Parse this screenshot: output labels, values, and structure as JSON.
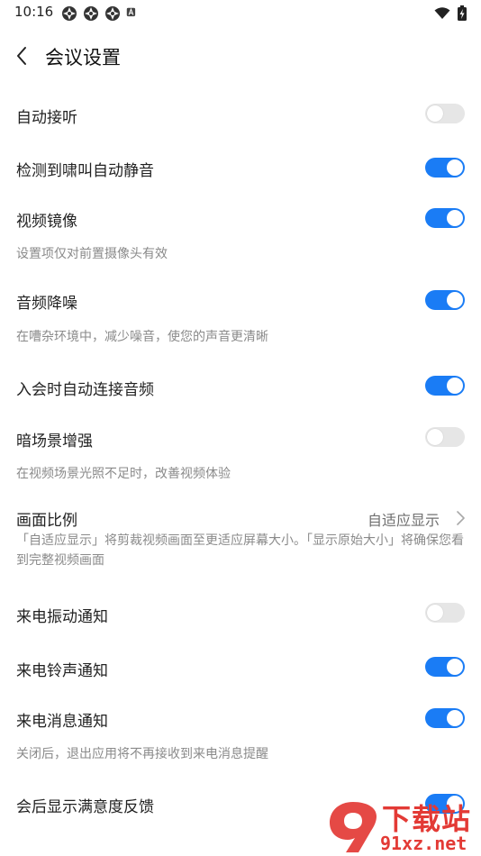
{
  "status_bar": {
    "time": "10:16",
    "notification_icons": [
      "app-notification-icon",
      "app-notification-icon",
      "app-notification-icon",
      "font-a-icon"
    ],
    "right_icons": [
      "wifi-icon",
      "battery-charging-icon"
    ]
  },
  "header": {
    "title": "会议设置"
  },
  "settings": {
    "auto_answer": {
      "label": "自动接听",
      "enabled": false
    },
    "howl_mute": {
      "label": "检测到啸叫自动静音",
      "enabled": true
    },
    "video_mirror": {
      "label": "视频镜像",
      "desc": "设置项仅对前置摄像头有效",
      "enabled": true
    },
    "audio_denoise": {
      "label": "音频降噪",
      "desc": "在嘈杂环境中，减少噪音，使您的声音更清晰",
      "enabled": true
    },
    "auto_audio": {
      "label": "入会时自动连接音频",
      "enabled": true
    },
    "low_light": {
      "label": "暗场景增强",
      "desc": "在视频场景光照不足时，改善视频体验",
      "enabled": false
    },
    "aspect_ratio": {
      "label": "画面比例",
      "value": "自适应显示",
      "desc": "「自适应显示」将剪裁视频画面至更适应屏幕大小。「显示原始大小」将确保您看到完整视频画面"
    },
    "call_vibrate": {
      "label": "来电振动通知",
      "enabled": false
    },
    "call_ring": {
      "label": "来电铃声通知",
      "enabled": true
    },
    "call_message": {
      "label": "来电消息通知",
      "desc": "关闭后，退出应用将不再接收到来电消息提醒",
      "enabled": true
    },
    "satisfaction": {
      "label": "会后显示满意度反馈",
      "enabled": true
    }
  },
  "watermark": {
    "top_text": "下载站",
    "bottom_text": "91xz.net"
  },
  "colors": {
    "toggle_on": "#1a7cf5",
    "toggle_off": "#e6e6e6",
    "watermark": "#e33a35"
  }
}
